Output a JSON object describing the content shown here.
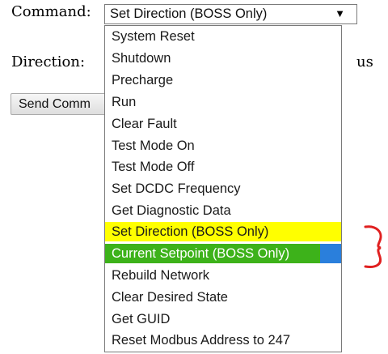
{
  "form": {
    "command_label": "Command:",
    "direction_label": "Direction:",
    "direction_suffix": "us",
    "send_button_label": "Send Comm"
  },
  "command_select": {
    "selected": "Set Direction (BOSS Only)",
    "arrow_icon": "triangle-down-icon"
  },
  "dropdown": {
    "options": [
      {
        "label": "System Reset"
      },
      {
        "label": "Shutdown"
      },
      {
        "label": "Precharge"
      },
      {
        "label": "Run"
      },
      {
        "label": "Clear Fault"
      },
      {
        "label": "Test Mode On"
      },
      {
        "label": "Test Mode Off"
      },
      {
        "label": "Set DCDC Frequency"
      },
      {
        "label": "Get Diagnostic Data"
      },
      {
        "label": "Set Direction (BOSS Only)",
        "highlight": "#ffff00"
      },
      {
        "label": "Current Setpoint (BOSS Only)",
        "highlight": "#3db21a",
        "hover_accent": "#2a7fdc"
      },
      {
        "label": "Rebuild Network"
      },
      {
        "label": "Clear Desired State"
      },
      {
        "label": "Get GUID"
      },
      {
        "label": "Reset Modbus Address to 247"
      }
    ]
  },
  "annotation": {
    "bracket_color": "#e02020"
  }
}
